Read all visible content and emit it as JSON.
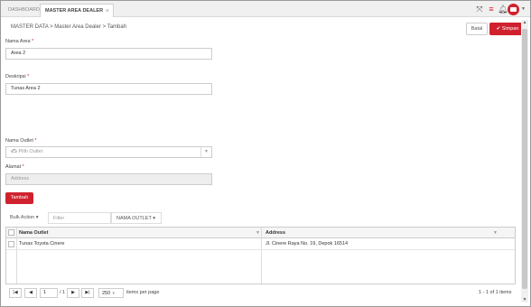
{
  "tabs": [
    {
      "label": "DASHBOARD",
      "active": false
    },
    {
      "label": "MASTER AREA DEALER",
      "active": true
    }
  ],
  "topbar": {
    "icons": [
      "fullscreen-icon",
      "menu-icon",
      "bell-icon",
      "user-avatar-icon",
      "chevron-down-icon"
    ],
    "accent_color": "#d0222e"
  },
  "breadcrumb": "MASTER DATA > Master Area Dealer > Tambah",
  "actions": {
    "batal_label": "Batal",
    "simpan_label": "Simpan"
  },
  "form": {
    "nama_area": {
      "label": "Nama Area",
      "value": "Area 2"
    },
    "deskripsi": {
      "label": "Deskripsi",
      "value": "Tunas Area 2"
    },
    "nama_outlet": {
      "label": "Nama Outlet",
      "placeholder": "Pilih Outlet"
    },
    "alamat": {
      "label": "Alamat",
      "placeholder": "Address"
    },
    "required_mark": "*",
    "tambah_label": "Tambah"
  },
  "grid_toolbar": {
    "bulk_action": "Bulk Action",
    "filter_placeholder": "Filter",
    "filter_column": "NAMA OUTLET"
  },
  "grid": {
    "columns": [
      "Nama Outlet",
      "Address"
    ],
    "rows": [
      {
        "nama_outlet": "Tunas Toyota Cinere",
        "address": "Jl. Cinere Raya No. 19, Depok 16514"
      }
    ]
  },
  "pager": {
    "first": "|◀",
    "prev": "◀",
    "next": "▶",
    "last": "▶|",
    "page": "1",
    "page_of": "/ 1",
    "page_size": "250",
    "page_size_label": "items per page",
    "summary": "1 - 1 of 1 items"
  }
}
